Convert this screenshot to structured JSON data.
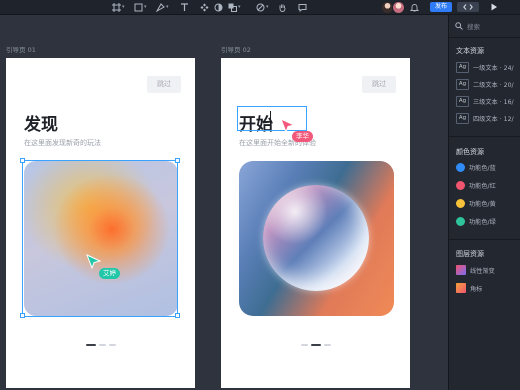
{
  "toolbar": {
    "publish_label": "发布",
    "tools": [
      "frame-tool",
      "rectangle-tool",
      "pen-tool",
      "text-tool",
      "component-tool",
      "boolean-tool",
      "prototype-tool",
      "hand-tool",
      "comment-tool"
    ]
  },
  "canvas": {
    "frames": [
      {
        "label": "引导页 01",
        "skip_label": "跳过",
        "title": "发现",
        "subtitle": "在这里面发现新奇的玩法",
        "cursor_user": "艾婷"
      },
      {
        "label": "引导页 02",
        "skip_label": "跳过",
        "title": "开始",
        "subtitle": "在这里面开始全新的体验",
        "cursor_user": "李华"
      }
    ]
  },
  "panel": {
    "search_placeholder": "搜索",
    "text_section": {
      "title": "文本资源",
      "items": [
        {
          "badge": "Ag",
          "label": "一级文本 · 24/"
        },
        {
          "badge": "Ag",
          "label": "二级文本 · 20/"
        },
        {
          "badge": "Ag",
          "label": "三级文本 · 16/"
        },
        {
          "badge": "Ag",
          "label": "四级文本 · 12/"
        }
      ]
    },
    "color_section": {
      "title": "颜色资源",
      "items": [
        {
          "label": "功能色/蓝",
          "color": "#2f8cf6"
        },
        {
          "label": "功能色/红",
          "color": "#f0556f"
        },
        {
          "label": "功能色/黄",
          "color": "#f6c23a"
        },
        {
          "label": "功能色/绿",
          "color": "#2fc39b"
        }
      ]
    },
    "layer_section": {
      "title": "图层资源",
      "items": [
        {
          "label": "线性渐变"
        },
        {
          "label": "角标"
        }
      ]
    }
  },
  "colors": {
    "accent": "#3aa3ff",
    "cursor_teal": "#22c7a9",
    "cursor_pink": "#f2587a",
    "publish": "#2f7cf6"
  }
}
